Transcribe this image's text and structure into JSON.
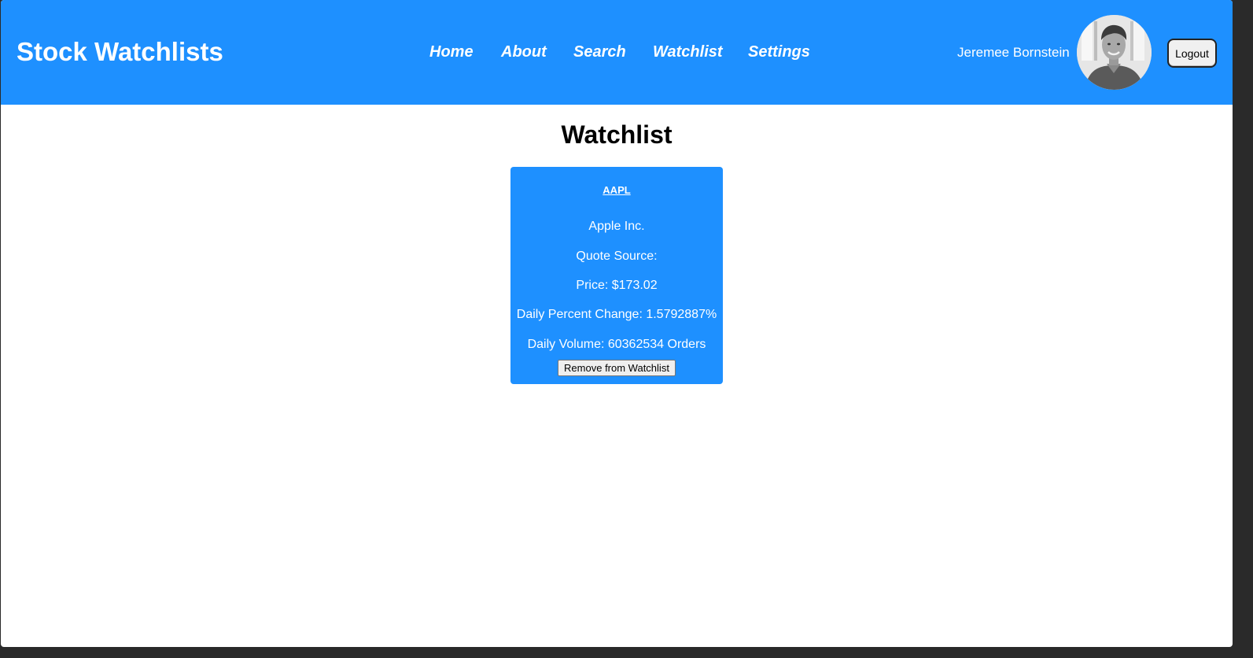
{
  "header": {
    "brand": "Stock Watchlists",
    "nav": [
      "Home",
      "About",
      "Search",
      "Watchlist",
      "Settings"
    ],
    "username": "Jeremee Bornstein",
    "logout_label": "Logout",
    "avatar_icon": "user-photo",
    "background_color": "#1e90ff"
  },
  "main": {
    "title": "Watchlist",
    "cards": [
      {
        "ticker": "AAPL",
        "company": "Apple Inc.",
        "quote_source": "Quote Source:",
        "price": "Price: $173.02",
        "daily_percent_change": "Daily Percent Change: 1.5792887%",
        "daily_volume": "Daily Volume: 60362534 Orders",
        "remove_label": "Remove from Watchlist"
      }
    ]
  }
}
